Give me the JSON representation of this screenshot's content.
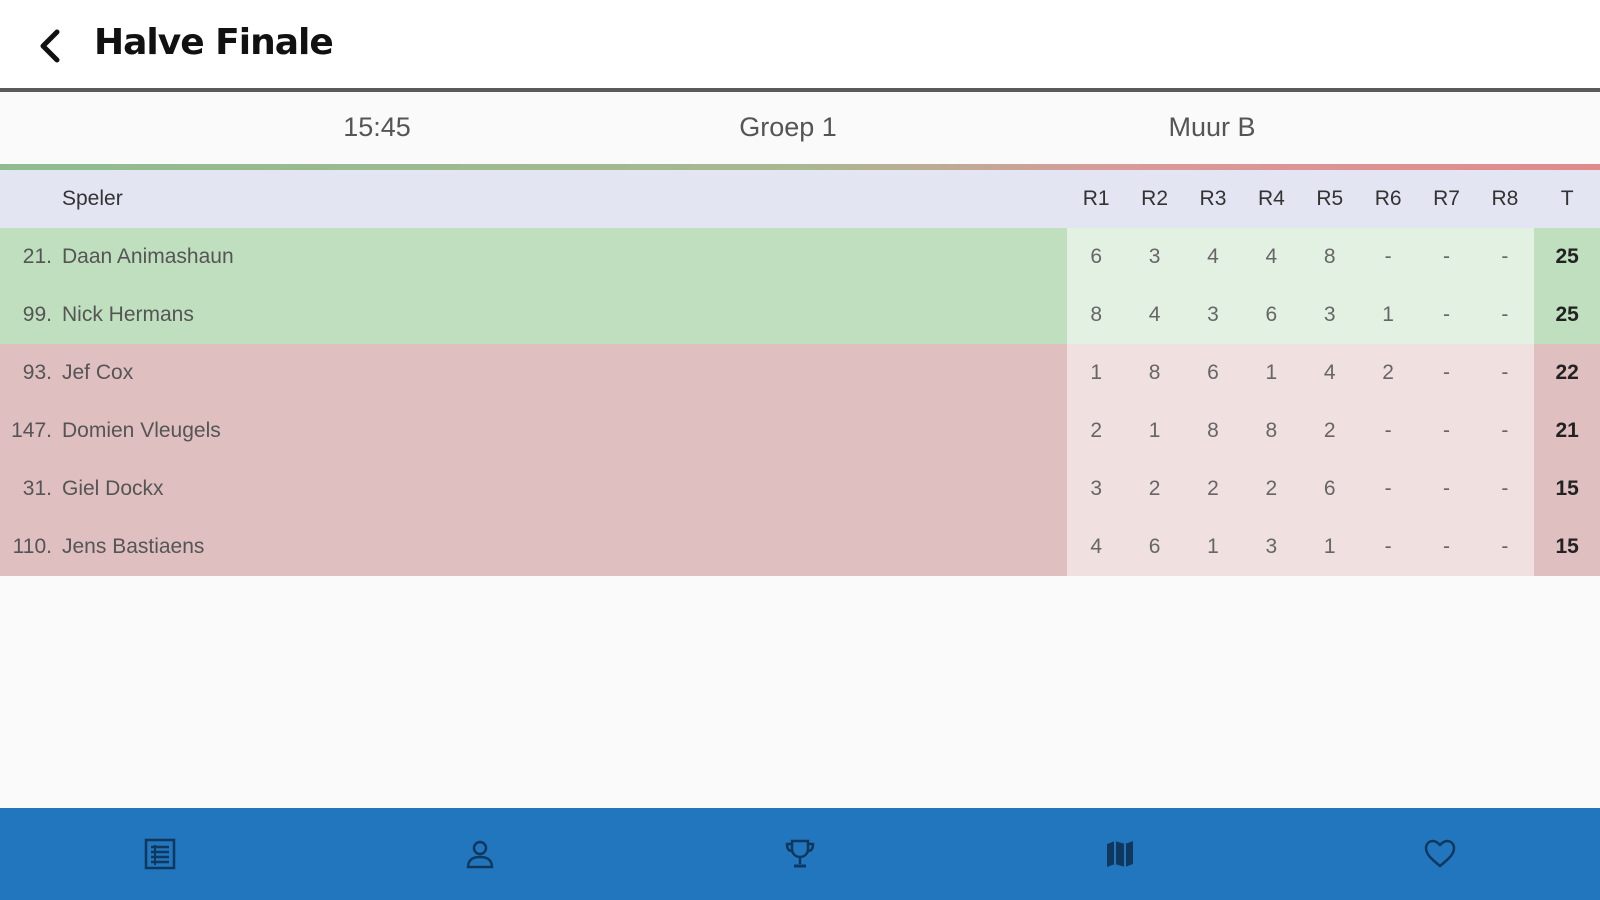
{
  "appbar": {
    "title": "Halve Finale"
  },
  "info": {
    "time": "15:45",
    "group": "Groep 1",
    "wall": "Muur B"
  },
  "table": {
    "headers": {
      "player": "Speler",
      "rounds": [
        "R1",
        "R2",
        "R3",
        "R4",
        "R5",
        "R6",
        "R7",
        "R8"
      ],
      "total": "T"
    },
    "rows": [
      {
        "rank": "21.",
        "name": "Daan Animashaun",
        "scores": [
          "6",
          "3",
          "4",
          "4",
          "8",
          "-",
          "-",
          "-"
        ],
        "total": "25",
        "status": "qual"
      },
      {
        "rank": "99.",
        "name": "Nick Hermans",
        "scores": [
          "8",
          "4",
          "3",
          "6",
          "3",
          "1",
          "-",
          "-"
        ],
        "total": "25",
        "status": "qual"
      },
      {
        "rank": "93.",
        "name": "Jef Cox",
        "scores": [
          "1",
          "8",
          "6",
          "1",
          "4",
          "2",
          "-",
          "-"
        ],
        "total": "22",
        "status": "elim"
      },
      {
        "rank": "147.",
        "name": "Domien Vleugels",
        "scores": [
          "2",
          "1",
          "8",
          "8",
          "2",
          "-",
          "-",
          "-"
        ],
        "total": "21",
        "status": "elim"
      },
      {
        "rank": "31.",
        "name": "Giel Dockx",
        "scores": [
          "3",
          "2",
          "2",
          "2",
          "6",
          "-",
          "-",
          "-"
        ],
        "total": "15",
        "status": "elim"
      },
      {
        "rank": "110.",
        "name": "Jens Bastiaens",
        "scores": [
          "4",
          "6",
          "1",
          "3",
          "1",
          "-",
          "-",
          "-"
        ],
        "total": "15",
        "status": "elim"
      }
    ]
  },
  "colors": {
    "nav_bg": "#2176be",
    "qualified": "#bfdfbf",
    "eliminated": "#dfbfc0",
    "header_bg": "#e3e6f2"
  },
  "bottom_nav": {
    "items": [
      {
        "icon": "list-icon"
      },
      {
        "icon": "person-icon"
      },
      {
        "icon": "trophy-icon"
      },
      {
        "icon": "map-icon"
      },
      {
        "icon": "heart-icon"
      }
    ]
  }
}
